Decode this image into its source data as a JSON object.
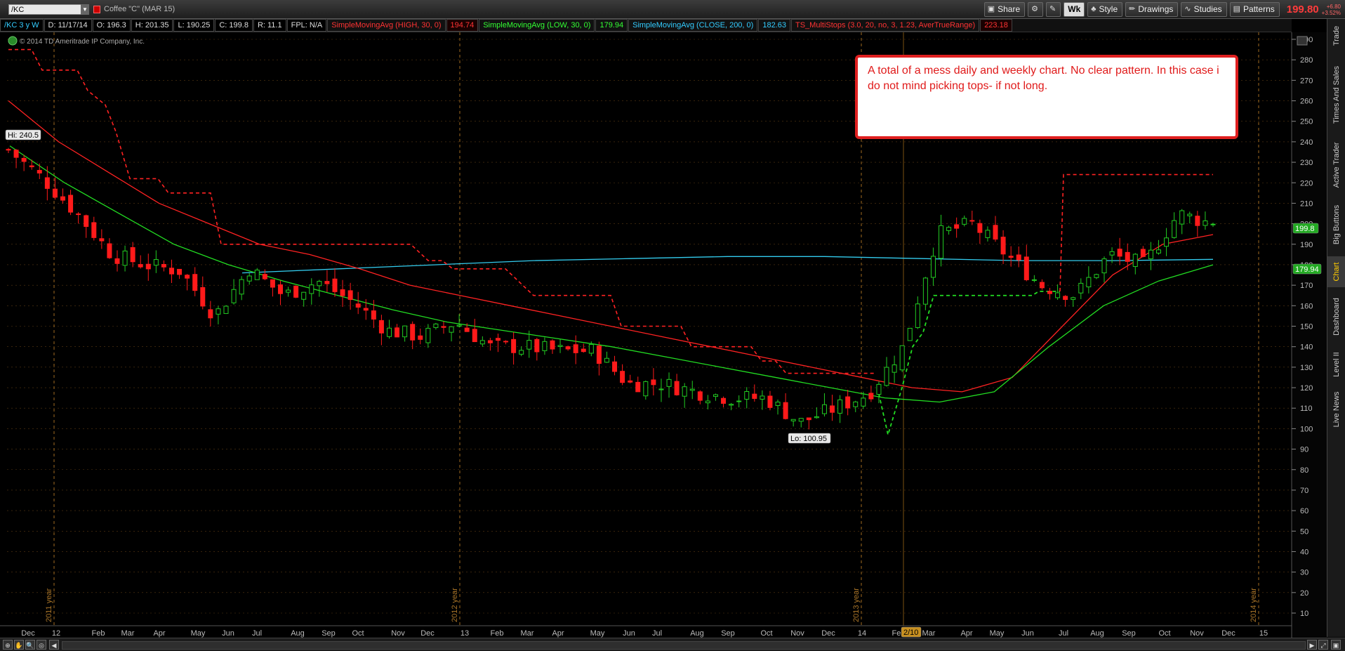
{
  "toolbar": {
    "symbol": "/KC",
    "description": "Coffee \"C\" (MAR 15)",
    "share_label": "Share",
    "period_label": "Wk",
    "style_label": "Style",
    "drawings_label": "Drawings",
    "studies_label": "Studies",
    "patterns_label": "Patterns",
    "last_price": "199.80",
    "change_abs": "+6.80",
    "change_pct": "+3.52%"
  },
  "studybar": {
    "symbol_period": "/KC 3 y W",
    "date": "D: 11/17/14",
    "open": "O: 196.3",
    "high": "H: 201.35",
    "low": "L: 190.25",
    "close": "C: 199.8",
    "range": "R: 11.1",
    "fpl": "FPL: N/A",
    "sma_high_label": "SimpleMovingAvg (HIGH, 30, 0)",
    "sma_high_value": "194.74",
    "sma_low_label": "SimpleMovingAvg (LOW, 30, 0)",
    "sma_low_value": "179.94",
    "sma_close_label": "SimpleMovingAvg (CLOSE, 200, 0)",
    "sma_close_value": "182.63",
    "multistops_label": "TS_MultiStops (3.0, 20, no, 3, 1.23, AverTrueRange)",
    "multistops_value": "223.18"
  },
  "chart": {
    "copyright": "2014 TD Ameritrade IP Company, Inc.",
    "hi_label": "Hi: 240.5",
    "lo_label": "Lo: 100.95",
    "price_tag_last": "199.8",
    "price_tag_sma": "179.94",
    "date_marker": "2/10",
    "y_ticks": [
      "290",
      "280",
      "270",
      "260",
      "250",
      "240",
      "230",
      "220",
      "210",
      "200",
      "190",
      "180",
      "170",
      "160",
      "150",
      "140",
      "130",
      "120",
      "110",
      "100",
      "90",
      "80",
      "70",
      "60",
      "50",
      "40",
      "30",
      "20",
      "10"
    ],
    "x_labels": [
      "Dec",
      "12",
      "Feb",
      "Mar",
      "Apr",
      "May",
      "Jun",
      "Jul",
      "Aug",
      "Sep",
      "Oct",
      "Nov",
      "Dec",
      "13",
      "Feb",
      "Mar",
      "Apr",
      "May",
      "Jun",
      "Jul",
      "Aug",
      "Sep",
      "Oct",
      "Nov",
      "Dec",
      "14",
      "Feb",
      "Mar",
      "Apr",
      "May",
      "Jun",
      "Jul",
      "Aug",
      "Sep",
      "Oct",
      "Nov",
      "Dec",
      "15"
    ],
    "year_labels": [
      "2011 year",
      "2012 year",
      "2013 year",
      "2014 year"
    ],
    "colors": {
      "up": "#22cc22",
      "down": "#ff1a1a",
      "sma_close": "#33ccee",
      "sma_high": "#ff2222",
      "sma_low": "#22dd22",
      "grid": "#5a3a14"
    }
  },
  "annotation": {
    "text": "A total of a mess daily and weekly chart. No clear pattern. In this case i do not mind picking tops- if not long."
  },
  "right_tabs": [
    "Trade",
    "Times And Sales",
    "Active Trader",
    "Big Buttons",
    "Chart",
    "Dashboard",
    "Level II",
    "Live News"
  ],
  "chart_data": {
    "type": "candlestick",
    "symbol": "/KC",
    "ylim": [
      0,
      295
    ],
    "weekly_close_approx": [
      {
        "date": "Dec 2011",
        "close": 236
      },
      {
        "date": "Jan 2012",
        "close": 222
      },
      {
        "date": "Feb 2012",
        "close": 205
      },
      {
        "date": "Mar 2012",
        "close": 185
      },
      {
        "date": "Apr 2012",
        "close": 180
      },
      {
        "date": "May 2012",
        "close": 177
      },
      {
        "date": "Jun 2012",
        "close": 155
      },
      {
        "date": "Jul 2012",
        "close": 178
      },
      {
        "date": "Aug 2012",
        "close": 165
      },
      {
        "date": "Sep 2012",
        "close": 172
      },
      {
        "date": "Oct 2012",
        "close": 162
      },
      {
        "date": "Nov 2012",
        "close": 148
      },
      {
        "date": "Dec 2012",
        "close": 145
      },
      {
        "date": "Jan 2013",
        "close": 152
      },
      {
        "date": "Feb 2013",
        "close": 140
      },
      {
        "date": "Mar 2013",
        "close": 140
      },
      {
        "date": "Apr 2013",
        "close": 138
      },
      {
        "date": "May 2013",
        "close": 138
      },
      {
        "date": "Jun 2013",
        "close": 122
      },
      {
        "date": "Jul 2013",
        "close": 122
      },
      {
        "date": "Aug 2013",
        "close": 118
      },
      {
        "date": "Sep 2013",
        "close": 115
      },
      {
        "date": "Oct 2013",
        "close": 115
      },
      {
        "date": "Nov 2013",
        "close": 103
      },
      {
        "date": "Dec 2013",
        "close": 110
      },
      {
        "date": "Jan 2014",
        "close": 117
      },
      {
        "date": "Feb 2014",
        "close": 140
      },
      {
        "date": "Mar 2014",
        "close": 195
      },
      {
        "date": "Apr 2014",
        "close": 200
      },
      {
        "date": "May 2014",
        "close": 185
      },
      {
        "date": "Jun 2014",
        "close": 170
      },
      {
        "date": "Jul 2014",
        "close": 165
      },
      {
        "date": "Aug 2014",
        "close": 185
      },
      {
        "date": "Sep 2014",
        "close": 180
      },
      {
        "date": "Oct 2014",
        "close": 205
      },
      {
        "date": "Nov 2014",
        "close": 199.8
      }
    ],
    "series": [
      {
        "name": "SimpleMovingAvg (HIGH, 30, 0)",
        "values": [
          260,
          240,
          225,
          210,
          200,
          190,
          185,
          178,
          170,
          165,
          160,
          155,
          150,
          145,
          140,
          135,
          130,
          125,
          120,
          118,
          125,
          150,
          175,
          190,
          194.74
        ]
      },
      {
        "name": "SimpleMovingAvg (LOW, 30, 0)",
        "values": [
          238,
          220,
          205,
          190,
          180,
          172,
          165,
          158,
          152,
          148,
          144,
          140,
          135,
          130,
          125,
          120,
          115,
          113,
          118,
          140,
          160,
          172,
          179.94
        ]
      },
      {
        "name": "SimpleMovingAvg (CLOSE, 200, 0)",
        "values": [
          176,
          178,
          180,
          182,
          183,
          184,
          184,
          183,
          182,
          182,
          182.63
        ]
      }
    ]
  }
}
